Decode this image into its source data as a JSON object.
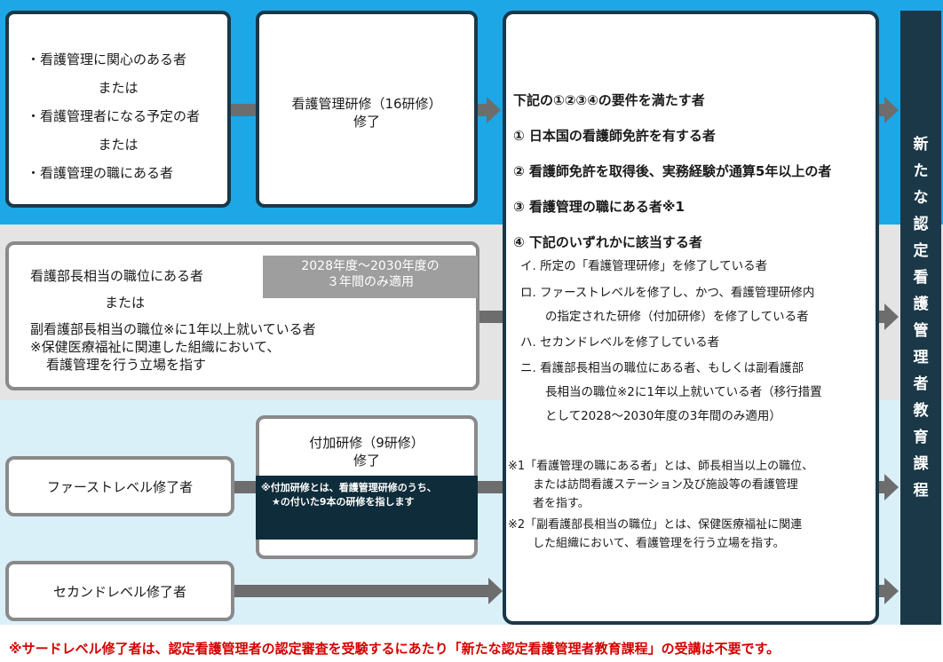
{
  "colors": {
    "blue_band": "#1da7e6",
    "gray_band": "#e4e4e4",
    "light_band": "#daf0f9",
    "box_border": "#1a3848",
    "arrow": "#6d6d6d",
    "footer_red": "#d40000"
  },
  "top_left": {
    "line1": "・看護管理に関心のある者",
    "or1": "または",
    "line2": "・看護管理者になる予定の者",
    "or2": "または",
    "line3": "・看護管理の職にある者"
  },
  "training16": {
    "line1": "看護管理研修（16研修）",
    "line2": "修了"
  },
  "middle": {
    "line1": "看護部長相当の職位にある者",
    "or": "または",
    "line2": "副看護部長相当の職位※に1年以上就いている者",
    "note1": "※保健医療福祉に関連した組織において、",
    "note2": "看護管理を行う立場を指す",
    "period_line1": "2028年度～2030年度の",
    "period_line2": "３年間のみ適用"
  },
  "first_level": {
    "label": "ファーストレベル修了者"
  },
  "additional": {
    "line1": "付加研修（9研修）",
    "line2": "修了",
    "note1": "※付加研修とは、看護管理研修のうち、",
    "note2": "★の付いた9本の研修を指します"
  },
  "second_level": {
    "label": "セカンドレベル修了者"
  },
  "requirements": {
    "title": "下記の①②③④の要件を満たす者",
    "r1": "①  日本国の看護師免許を有する者",
    "r2": "②  看護師免許を取得後、実務経験が通算5年以上の者",
    "r3": "③    看護管理の職にある者※1",
    "r4": "④    下記のいずれかに該当する者",
    "i": "イ. 所定の「看護管理研修」を修了している者",
    "ro1": "ロ. ファーストレベルを修了し、かつ、看護管理研修内",
    "ro2": "の指定された研修（付加研修）を修了している者",
    "ha": "ハ. セカンドレベルを修了している者",
    "ni1": "ニ. 看護部長相当の職位にある者、もしくは副看護部",
    "ni2": "長相当の職位※2に1年以上就いている者（移行措置",
    "ni3": "として2028～2030年度の3年間のみ適用）",
    "fn1a": "※1「看護管理の職にある者」とは、師長相当以上の職位、",
    "fn1b": "または訪問看護ステーション及び施設等の看護管理",
    "fn1c": "者を指す。",
    "fn2a": "※2「副看護部長相当の職位」とは、保健医療福祉に関連",
    "fn2b": "した組織において、看護管理を行う立場を指す。"
  },
  "vertical_title": [
    "新",
    "た",
    "な",
    "認",
    "定",
    "看",
    "護",
    "管",
    "理",
    "者",
    "教",
    "育",
    "課",
    "程"
  ],
  "footer": "※サードレベル修了者は、認定看護管理者の認定審査を受験するにあたり「新たな認定看護管理者教育課程」の受講は不要です。"
}
